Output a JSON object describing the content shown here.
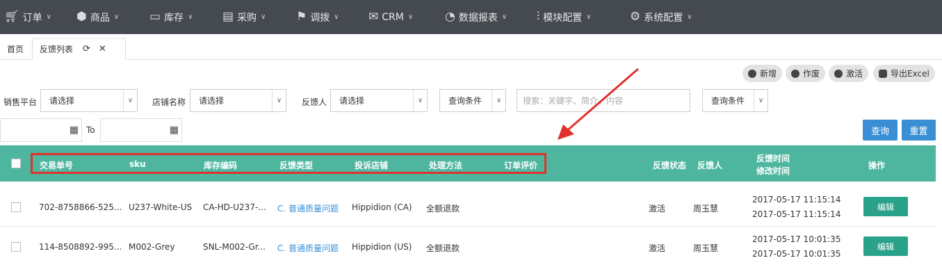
{
  "nav": {
    "items": [
      {
        "label": "订单",
        "icon": "cart-icon"
      },
      {
        "label": "商品",
        "icon": "cube-icon"
      },
      {
        "label": "库存",
        "icon": "inbox-icon"
      },
      {
        "label": "采购",
        "icon": "card-icon"
      },
      {
        "label": "调拨",
        "icon": "signpost-icon"
      },
      {
        "label": "CRM",
        "icon": "envelope-icon"
      },
      {
        "label": "数据报表",
        "icon": "pie-icon"
      },
      {
        "label": "模块配置",
        "icon": "sliders-icon"
      },
      {
        "label": "系统配置",
        "icon": "gear-icon"
      }
    ]
  },
  "tabs": {
    "home": "首页",
    "feedback_list": "反馈列表"
  },
  "actions": {
    "add": "新增",
    "void": "作废",
    "activate": "激活",
    "export": "导出Excel"
  },
  "filters": {
    "platform_label": "销售平台",
    "platform_value": "请选择",
    "shop_label": "店铺名称",
    "shop_value": "请选择",
    "feedback_user_label": "反馈人",
    "feedback_user_value": "请选择",
    "query_condition_1": "查询条件",
    "search_placeholder": "搜索：关键字、简介、内容",
    "query_condition_2": "查询条件",
    "date_to": "To",
    "search_button": "查询",
    "reset_button": "重置"
  },
  "table": {
    "headers": {
      "trade_no": "交易单号",
      "sku": "sku",
      "stock_code": "库存编码",
      "feedback_type": "反馈类型",
      "complaint_shop": "投诉店铺",
      "handling": "处理方法",
      "order_review": "订单评价",
      "status": "反馈状态",
      "user": "反馈人",
      "time1": "反馈时间",
      "time2": "修改时间",
      "ops": "操作"
    },
    "rows": [
      {
        "trade_no": "702-8758866-525...",
        "sku": "U237-White-US",
        "stock_code": "CA-HD-U237-...",
        "feedback_type": "C. 普通质量问题",
        "complaint_shop": "Hippidion (CA)",
        "handling": "全额退款",
        "status": "激活",
        "user": "周玉慧",
        "feedback_time": "2017-05-17 11:15:14",
        "modified_time": "2017-05-17 11:15:14",
        "edit": "编辑"
      },
      {
        "trade_no": "114-8508892-995...",
        "sku": "M002-Grey",
        "stock_code": "SNL-M002-Gr...",
        "feedback_type": "C. 普通质量问题",
        "complaint_shop": "Hippidion (US)",
        "handling": "全额退款",
        "status": "激活",
        "user": "周玉慧",
        "feedback_time": "2017-05-17 10:01:35",
        "modified_time": "2017-05-17 10:01:35",
        "edit": "编辑"
      }
    ]
  },
  "colors": {
    "nav_bg": "#454950",
    "header_bg": "#4eb69f",
    "primary": "#3a8fd4",
    "edit": "#2aa18a",
    "highlight": "#e0312c"
  }
}
